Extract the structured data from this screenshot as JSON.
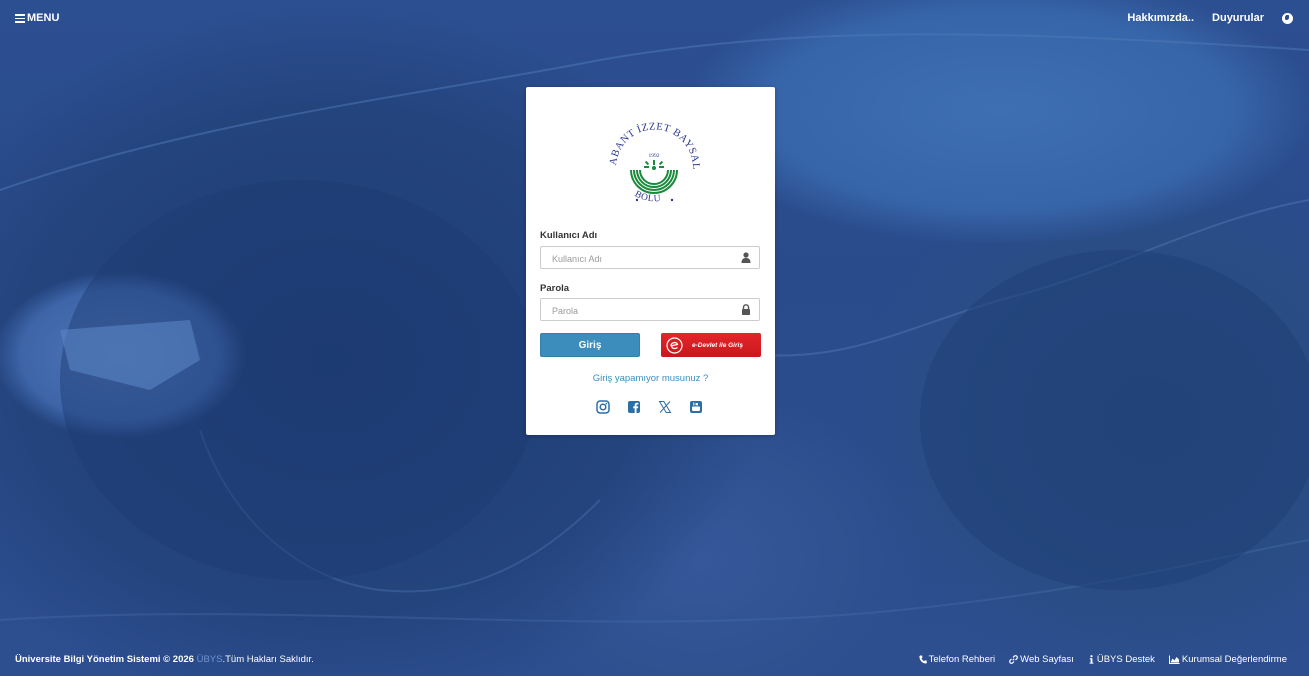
{
  "topbar": {
    "menu_label": "MENU",
    "about_label": "Hakkımızda..",
    "announcements_label": "Duyurular"
  },
  "login": {
    "logo_text": {
      "arc_text": "ABANT İZZET BAYSAL ÜNİVERSİTESİ",
      "bottom_text": "BOLU",
      "year": "1992"
    },
    "username_label": "Kullanıcı Adı",
    "username_placeholder": "Kullanıcı Adı",
    "username_value": "",
    "password_label": "Parola",
    "password_placeholder": "Parola",
    "password_value": "",
    "login_button": "Giriş",
    "edevlet_button": "e-Devlet ile Giriş",
    "trouble_link": "Giriş yapamıyor musunuz ?",
    "social": [
      "instagram-icon",
      "facebook-icon",
      "x-icon",
      "youtube-icon"
    ]
  },
  "footer": {
    "system_name": "Üniversite Bilgi Yönetim Sistemi © 2026",
    "brand": "ÜBYS",
    "rights": ".Tüm Hakları Saklıdır.",
    "links": {
      "phone": "Telefon Rehberi",
      "web": "Web Sayfası",
      "support": "ÜBYS Destek",
      "evaluation": "Kurumsal Değerlendirme"
    }
  },
  "colors": {
    "primary": "#3c8dbc",
    "edevlet_red": "#d71f24",
    "logo_green": "#1a8a3c",
    "logo_blue": "#2b3990",
    "overlay_blue": "#2a4a8c"
  }
}
